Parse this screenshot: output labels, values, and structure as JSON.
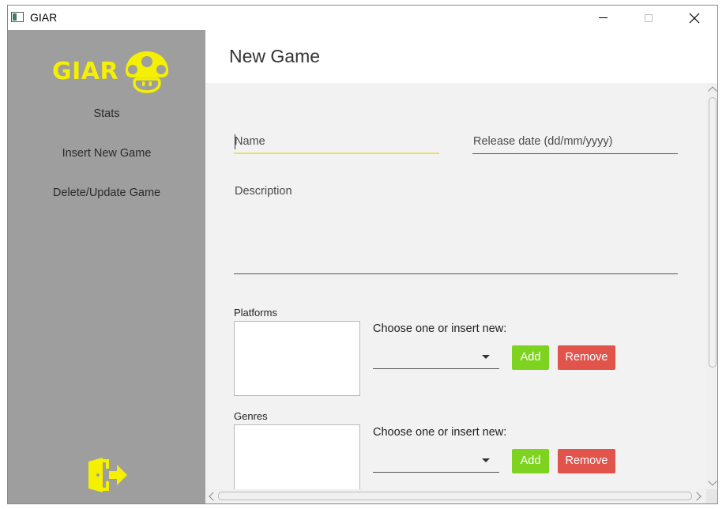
{
  "window": {
    "title": "GIAR",
    "app_icon": "window-app-icon",
    "controls": [
      "minimize-icon",
      "maximize-icon",
      "close-icon"
    ]
  },
  "sidebar": {
    "logo_text": "GIAR",
    "logo_icon": "mushroom-icon",
    "items": [
      {
        "label": "Stats"
      },
      {
        "label": "Insert New Game"
      },
      {
        "label": "Delete/Update Game"
      }
    ],
    "exit_icon": "exit-door-icon",
    "background": "#9e9e9e",
    "accent": "#f5f000"
  },
  "header": {
    "title": "New Game"
  },
  "form": {
    "name": {
      "value": "",
      "placeholder": "Name"
    },
    "release_date": {
      "value": "",
      "placeholder": "Release date (dd/mm/yyyy)"
    },
    "description": {
      "value": "",
      "placeholder": "Description"
    },
    "platforms": {
      "label": "Platforms",
      "items": [],
      "choose_label": "Choose one or insert new:",
      "combo_value": "",
      "add_label": "Add",
      "remove_label": "Remove"
    },
    "genres": {
      "label": "Genres",
      "items": [],
      "choose_label": "Choose one or insert new:",
      "combo_value": "",
      "add_label": "Add",
      "remove_label": "Remove"
    }
  },
  "colors": {
    "add_button": "#7ed321",
    "remove_button": "#e0544c",
    "focus_underline": "#e8e060"
  }
}
